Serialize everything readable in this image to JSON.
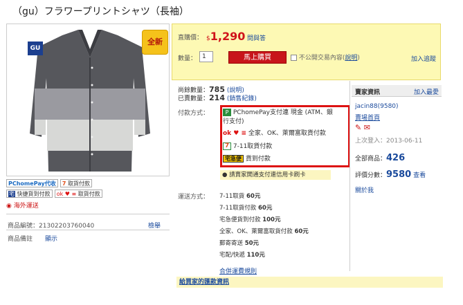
{
  "product_title": "（gu）フラワープリントシャツ（長袖）",
  "image": {
    "logo": "GU",
    "badge": "全新"
  },
  "payment_badges": {
    "row1": [
      {
        "text": "PChomePay代收"
      },
      {
        "text": "取貨付款"
      }
    ],
    "row2": [
      {
        "text": "快捷貨到付款"
      },
      {
        "text": "取貨付款"
      }
    ],
    "overseas": "海外運送"
  },
  "meta": {
    "code_label": "商品編號：",
    "code_value": "21302203760040",
    "report": "檢舉",
    "note_label": "商品備註",
    "note_link": "顯示"
  },
  "buy": {
    "price_label": "直購價：",
    "currency": "$",
    "price": "1,290",
    "qa": "問與答",
    "qty_label": "數量：",
    "qty": "1",
    "buy_button": "馬上購買",
    "private_label": "不公開交易內容(",
    "private_link": "說明",
    "private_close": ")",
    "track": "加入追蹤"
  },
  "stock": {
    "remain_label": "尚餘數量：",
    "remain": "785",
    "remain_link": "(說明)",
    "sold_label": "已賣數量：",
    "sold": "214",
    "sold_link": "(銷售紀錄)"
  },
  "payment": {
    "label": "付款方式：",
    "line1": "PChomePay支付連 現金 (ATM、銀",
    "line1b": "行支付)",
    "line2": "全家、OK、萊爾富取貨付款",
    "line3": "7-11取貨付款",
    "line4": "貨到付款",
    "kuro": "宅急便",
    "note": "請賣家開通支付連信用卡刷卡"
  },
  "shipping": {
    "label": "運送方式：",
    "items": [
      {
        "name": "7-11取貨",
        "price": "60元"
      },
      {
        "name": "7-11取貨付款",
        "price": "60元"
      },
      {
        "name": "宅急便貨到付款",
        "price": "100元"
      },
      {
        "name": "全家、OK、萊爾富取貨付款",
        "price": "60元"
      },
      {
        "name": "郵寄寄送",
        "price": "50元"
      },
      {
        "name": "宅配/快遞",
        "price": "110元"
      }
    ],
    "merge": "合併運費規則"
  },
  "gift_bar": "給買家的匯款資訊",
  "seller": {
    "title": "賣家資訊",
    "fav": "加入最愛",
    "name": "jacin88(9580)",
    "shop": "賣場首頁",
    "last_login_label": "上次登入：",
    "last_login": "2013-06-11",
    "total_label": "全部商品：",
    "total": "426",
    "rating_label": "評價分數：",
    "rating": "9580",
    "rating_link": "查看",
    "about": "關於我"
  },
  "colors": {
    "price": "#d0141b",
    "link": "#1a4a9c",
    "buy_bg": "#fdf9b4",
    "highlight": "#d11"
  }
}
